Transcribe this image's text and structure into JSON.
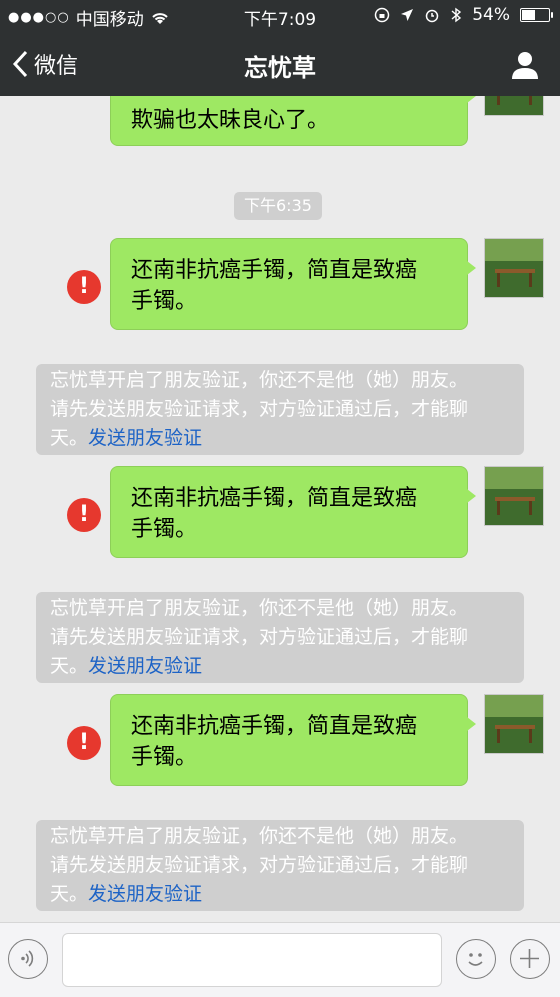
{
  "status": {
    "carrier": "中国移动",
    "time": "下午7:09",
    "battery": "54%",
    "battery_level": 0.54
  },
  "nav": {
    "back_label": "微信",
    "title": "忘忧草"
  },
  "chat": {
    "partial_message_line": "欺骗也太昧良心了。",
    "timestamp": "下午6:35",
    "messages": [
      {
        "line1": "还南非抗癌手镯，简直是致癌",
        "line2": "手镯。",
        "error": "!"
      },
      {
        "line1": "还南非抗癌手镯，简直是致癌",
        "line2": "手镯。",
        "error": "!"
      },
      {
        "line1": "还南非抗癌手镯，简直是致癌",
        "line2": "手镯。",
        "error": "!"
      }
    ],
    "system": {
      "line1": "忘忧草开启了朋友验证，你还不是他（她）朋友。",
      "line2": "请先发送朋友验证请求，对方验证通过后，才能聊",
      "line3": "天。",
      "link": "发送朋友验证"
    }
  },
  "colors": {
    "nav_bg": "#2e3132",
    "bubble_green": "#9ee863",
    "error_red": "#e6382e",
    "link_blue": "#1d63c6",
    "chat_bg": "#ebebeb"
  },
  "icons": {
    "back": "chevron-left-icon",
    "profile": "person-icon",
    "wifi": "wifi-icon",
    "voice": "voice-icon",
    "emoji": "emoji-icon",
    "plus": "plus-icon"
  }
}
